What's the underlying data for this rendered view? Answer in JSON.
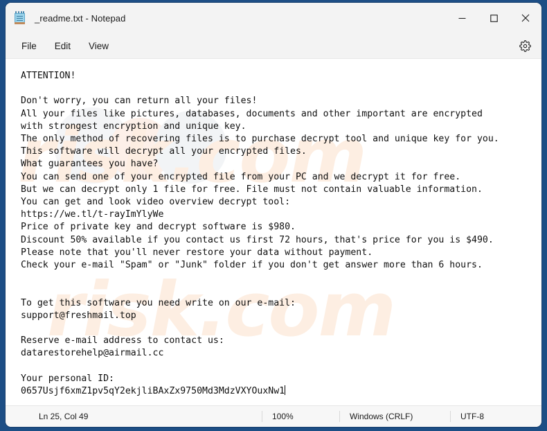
{
  "window": {
    "title": "_readme.txt - Notepad",
    "app_icon": "notepad-icon",
    "controls": {
      "minimize": "minimize-icon",
      "maximize": "maximize-icon",
      "close": "close-icon"
    }
  },
  "menu": {
    "items": [
      {
        "label": "File"
      },
      {
        "label": "Edit"
      },
      {
        "label": "View"
      }
    ],
    "settings_icon": "gear-icon"
  },
  "editor": {
    "watermark": "risk.com",
    "content": "ATTENTION!\n\nDon't worry, you can return all your files!\nAll your files like pictures, databases, documents and other important are encrypted\nwith strongest encryption and unique key.\nThe only method of recovering files is to purchase decrypt tool and unique key for you.\nThis software will decrypt all your encrypted files.\nWhat guarantees you have?\nYou can send one of your encrypted file from your PC and we decrypt it for free.\nBut we can decrypt only 1 file for free. File must not contain valuable information.\nYou can get and look video overview decrypt tool:\nhttps://we.tl/t-rayImYlyWe\nPrice of private key and decrypt software is $980.\nDiscount 50% available if you contact us first 72 hours, that's price for you is $490.\nPlease note that you'll never restore your data without payment.\nCheck your e-mail \"Spam\" or \"Junk\" folder if you don't get answer more than 6 hours.\n\n\nTo get this software you need write on our e-mail:\nsupport@freshmail.top\n\nReserve e-mail address to contact us:\ndatarestorehelp@airmail.cc\n\nYour personal ID:\n0657Usjf6xmZ1pv5qY2ekjliBAxZx9750Md3MdzVXYOuxNw1",
    "ransom_details": {
      "payment_url": "https://we.tl/t-rayImYlyWe",
      "price": "$980",
      "discount_price": "$490",
      "discount_percent": "50%",
      "discount_window": "72 hours",
      "response_time": "6 hours",
      "primary_email": "support@freshmail.top",
      "reserve_email": "datarestorehelp@airmail.cc",
      "personal_id": "0657Usjf6xmZ1pv5qY2ekjliBAxZx9750Md3MdzVXYOuxNw1"
    }
  },
  "status": {
    "position": "Ln 25, Col 49",
    "zoom": "100%",
    "line_ending": "Windows (CRLF)",
    "encoding": "UTF-8"
  },
  "colors": {
    "desktop": "#1d4e85",
    "window_chrome": "#f3f3f3",
    "editor_bg": "#ffffff",
    "watermark": "#fdeee2",
    "close_hover": "#c42b1c"
  }
}
